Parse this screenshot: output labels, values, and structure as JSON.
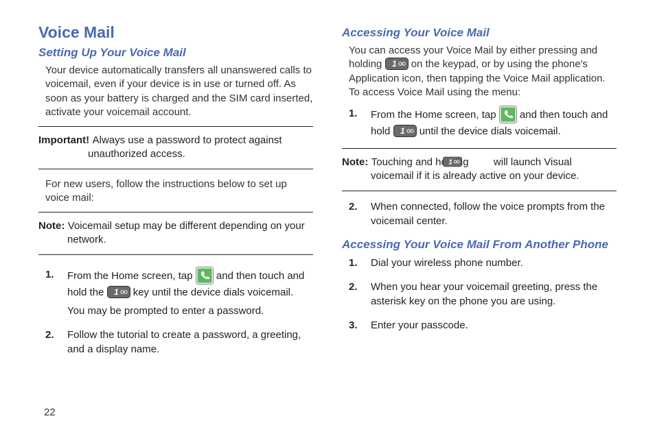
{
  "page_number": "22",
  "left": {
    "title": "Voice Mail",
    "sub1": "Setting Up Your Voice Mail",
    "intro": "Your device automatically transfers all unanswered calls to voicemail, even if your device is in use or turned off. As soon as your battery is charged and the SIM card inserted, activate your voicemail account.",
    "important_label": "Important!",
    "important_text": "Always use a password to protect against unauthorized access.",
    "new_users": "For new users, follow the instructions below to set up voice mail:",
    "note_label": "Note:",
    "note_text": "Voicemail setup may be different depending on your network.",
    "steps": [
      {
        "n": "1.",
        "a": "From the Home screen, tap ",
        "b": " and then touch and hold the ",
        "c": " key until the device dials voicemail.",
        "d": "You may be prompted to enter a password."
      },
      {
        "n": "2.",
        "a": "Follow the tutorial to create a password, a greeting, and a display name."
      }
    ]
  },
  "right": {
    "sub1": "Accessing Your Voice Mail",
    "intro_a": "You can access your Voice Mail by either pressing and holding ",
    "intro_b": " on the keypad, or by using the phone's Application icon, then tapping the Voice Mail application. To access Voice Mail using the menu:",
    "steps1": [
      {
        "n": "1.",
        "a": "From the Home screen, tap ",
        "b": " and then touch and hold ",
        "c": " until the device dials voicemail."
      }
    ],
    "note_label": "Note:",
    "note_a": "Touching and holding ",
    "note_b": " will launch Visual voicemail if it is already active on your device.",
    "steps2": [
      {
        "n": "2.",
        "a": "When connected, follow the voice prompts from the voicemail center."
      }
    ],
    "sub2": "Accessing Your Voice Mail From Another Phone",
    "steps3": [
      {
        "n": "1.",
        "a": "Dial your wireless phone number."
      },
      {
        "n": "2.",
        "a": "When you hear your voicemail greeting, press the asterisk key on the phone you are using."
      },
      {
        "n": "3.",
        "a": "Enter your passcode."
      }
    ]
  }
}
